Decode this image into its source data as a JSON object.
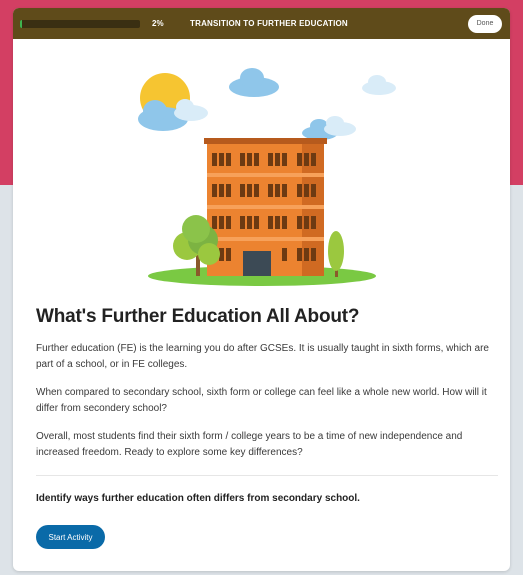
{
  "topbar": {
    "progress_percent": 2,
    "progress_label": "2%",
    "title": "TRANSITION TO FURTHER EDUCATION",
    "done_label": "Done"
  },
  "illustration": {
    "icon": "school-building-illustration"
  },
  "main": {
    "heading": "What's Further Education All About?",
    "paragraphs": [
      "Further education (FE) is the learning you do after GCSEs. It is usually taught in sixth forms, which are part of a school, or in FE colleges.",
      "When compared to secondary school, sixth form or college can feel like a whole new world. How will it differ from secondery school?",
      "Overall, most students find their sixth form / college years to be a time of new independence and increased freedom. Ready to explore some key differences?"
    ],
    "objective": "Identify ways further education often differs from secondary school.",
    "start_label": "Start Activity"
  },
  "colors": {
    "accent_bg": "#d33f63",
    "topbar": "#5f4b1a",
    "progress": "#3fb34f",
    "button": "#0a6aa8"
  }
}
